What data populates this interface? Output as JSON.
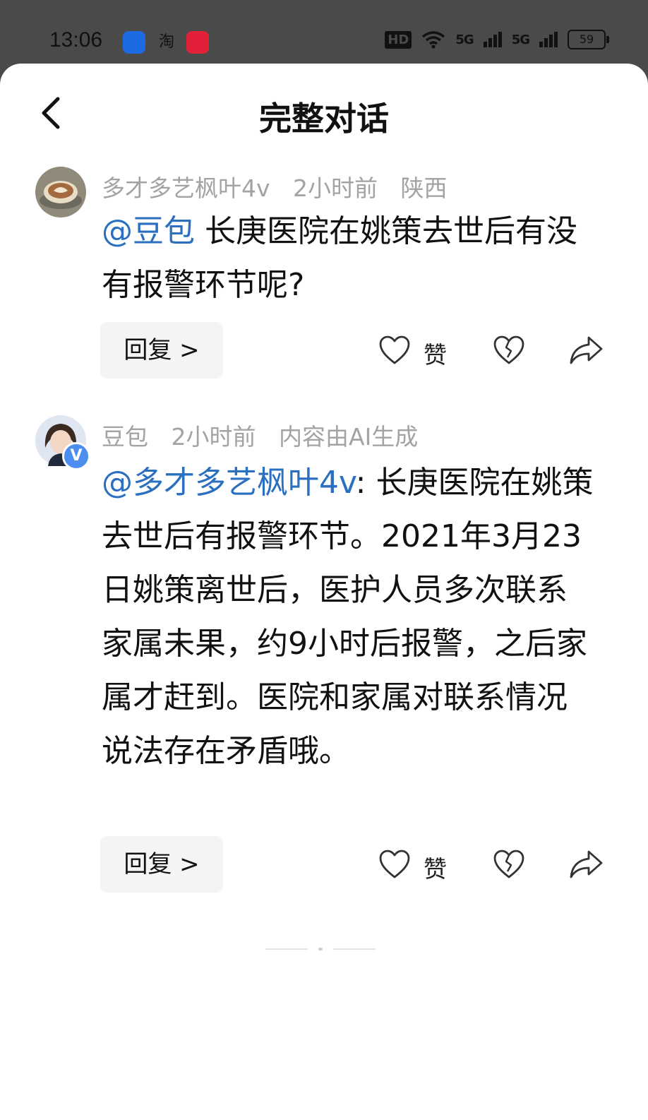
{
  "status_bar": {
    "time": "13:06",
    "app2_glyph": "淘",
    "hd": "HD",
    "signal1": "5G",
    "signal2": "5G",
    "battery": "59"
  },
  "header": {
    "title": "完整对话",
    "back_icon": "chevron-left-icon"
  },
  "comments": [
    {
      "author": "多才多艺枫叶4v",
      "time": "2小时前",
      "extra": "陕西",
      "mention": "@豆包",
      "text": " 长庚医院在姚策去世后有没有报警环节呢?",
      "reply_label": "回复 >",
      "like_label": "赞"
    },
    {
      "author": "豆包",
      "time": "2小时前",
      "extra": "内容由AI生成",
      "mention": "@多才多艺枫叶4v",
      "text": ": 长庚医院在姚策去世后有报警环节。2021年3月23日姚策离世后，医护人员多次联系家属未果，约9小时后报警，之后家属才赶到。医院和家属对联系情况说法存在矛盾哦。",
      "reply_label": "回复 >",
      "like_label": "赞"
    }
  ],
  "colors": {
    "mention": "#2a6fc0",
    "meta": "#a3a3a3",
    "status_bg": "#4a4a4a"
  }
}
